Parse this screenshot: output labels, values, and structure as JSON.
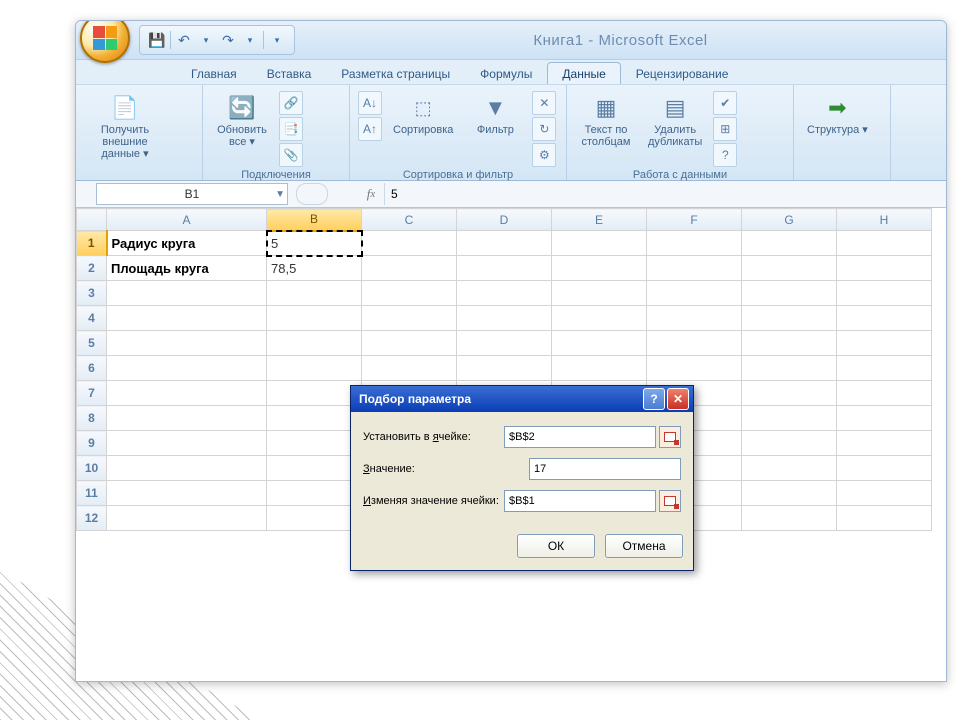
{
  "title": {
    "doc": "Книга1",
    "app": "Microsoft Excel"
  },
  "tabs": [
    "Главная",
    "Вставка",
    "Разметка страницы",
    "Формулы",
    "Данные",
    "Рецензирование"
  ],
  "ribbon": {
    "ext": {
      "label1": "Получить",
      "label2": "внешние данные"
    },
    "conn": {
      "refresh1": "Обновить",
      "refresh2": "все",
      "group": "Подключения"
    },
    "sort": {
      "sort": "Сортировка",
      "filter": "Фильтр",
      "group": "Сортировка и фильтр"
    },
    "tools": {
      "ttc1": "Текст по",
      "ttc2": "столбцам",
      "dup1": "Удалить",
      "dup2": "дубликаты",
      "group": "Работа с данными"
    },
    "outline": {
      "label": "Структура"
    }
  },
  "formulaBar": {
    "cellRef": "B1",
    "value": "5"
  },
  "columns": [
    "A",
    "B",
    "C",
    "D",
    "E",
    "F",
    "G",
    "H"
  ],
  "cells": {
    "A1": "Радиус круга",
    "B1": "5",
    "A2": "Площадь круга",
    "B2": "78,5"
  },
  "dialog": {
    "title": "Подбор параметра",
    "setCell": {
      "pre": "Установить в ",
      "u": "я",
      "post": "чейке:",
      "value": "$B$2"
    },
    "toValue": {
      "u": "З",
      "post": "начение:",
      "value": "17"
    },
    "byChanging": {
      "u": "И",
      "post": "зменяя значение ячейки:",
      "value": "$B$1"
    },
    "ok": "ОК",
    "cancel": "Отмена"
  }
}
